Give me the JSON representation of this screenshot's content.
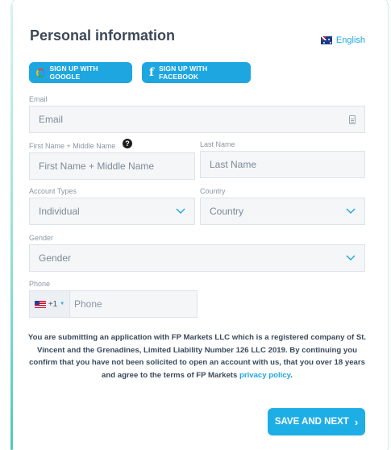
{
  "header": {
    "title": "Personal information",
    "language": "English",
    "language_flag_icon": "australia-flag-icon"
  },
  "social": {
    "google_label": "SIGN UP WITH GOOGLE",
    "facebook_label": "SIGN UP WITH FACEBOOK"
  },
  "fields": {
    "email": {
      "label": "Email",
      "placeholder": "Email",
      "icon": "contact-card-icon"
    },
    "first_name": {
      "label": "First Name + Middle Name",
      "placeholder": "First Name + Middle Name",
      "help_icon": "question-circle-icon",
      "help_glyph": "?"
    },
    "last_name": {
      "label": "Last Name",
      "placeholder": "Last Name"
    },
    "account_type": {
      "label": "Account Types",
      "value": "Individual"
    },
    "country": {
      "label": "Country",
      "value": "Country"
    },
    "gender": {
      "label": "Gender",
      "value": "Gender"
    },
    "phone": {
      "label": "Phone",
      "country_code": "+1",
      "placeholder": "Phone",
      "flag_icon": "us-flag-icon"
    }
  },
  "notice": {
    "text": "You are submitting an application with FP Markets LLC which is a registered company of St. Vincent and the Grenadines, Limited Liability Number 126 LLC 2019. By continuing you confirm that you have not been solicited to open an account with us, that you over 18 years and agree to the terms of FP Markets ",
    "link_text": "privacy policy",
    "end": "."
  },
  "actions": {
    "save_label": "SAVE AND NEXT",
    "save_arrow": "›"
  },
  "colors": {
    "accent": "#1ea6e0",
    "title": "#3c4858",
    "field_bg": "#f4f6f8",
    "card_border": "#cdeee8"
  }
}
